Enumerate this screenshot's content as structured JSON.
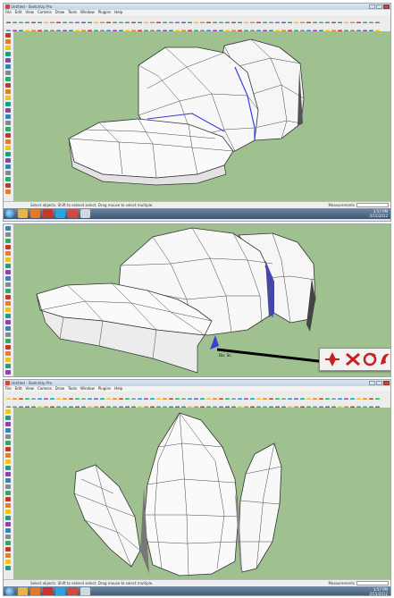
{
  "window": {
    "title": "Untitled - SketchUp Pro",
    "title_panel2": "",
    "title_panel3": "Untitled - SketchUp Pro"
  },
  "menu": [
    "File",
    "Edit",
    "View",
    "Camera",
    "Draw",
    "Tools",
    "Window",
    "Plugins",
    "Help"
  ],
  "status": {
    "message": "Select objects. Shift to extend select. Drag mouse to select multiple.",
    "measurements_label": "Measurements"
  },
  "taskbar": {
    "clock_time": "3:57 PM",
    "clock_date": "2/15/2012"
  },
  "panel2_tooltip": "Dis. Sc.",
  "colors": {
    "viewport": "#9fc08f",
    "taskbar": "#3e5671",
    "selected_edge": "#3a3fd6",
    "arrow": "#000000"
  },
  "icons": {
    "floating_toolbar": [
      "move-icon",
      "rotate-icon",
      "scale-icon",
      "offset-icon"
    ]
  }
}
